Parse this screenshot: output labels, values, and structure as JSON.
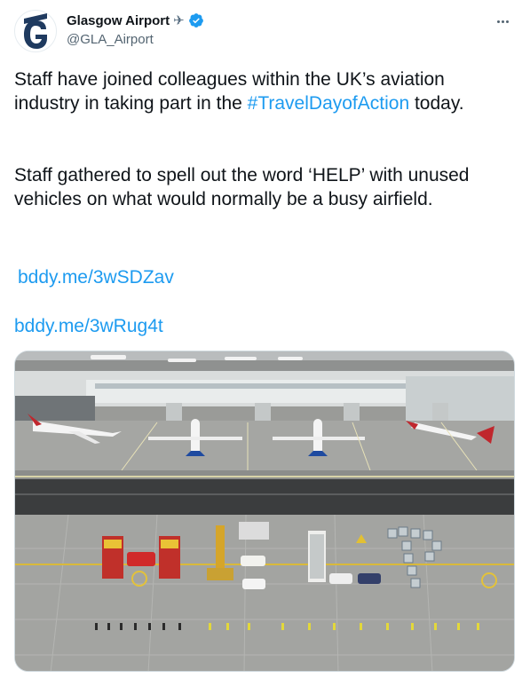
{
  "account": {
    "display_name": "Glasgow Airport",
    "name_emoji": "✈",
    "handle": "@GLA_Airport",
    "avatar_letter": "G"
  },
  "tweet": {
    "p1_text": "Staff have joined colleagues within the UK’s aviation industry in taking part in the ",
    "p1_hashtag": "#TravelDayofAction",
    "p1_end": " today.",
    "p2_text": "Staff gathered to spell out the word ‘HELP’ with unused vehicles on what would normally be a busy airfield.",
    "link1": "bddy.me/3wSDZav",
    "link2": "bddy.me/3wRug4t"
  },
  "colors": {
    "link": "#1d9bf0",
    "verified": "#1d9bf0",
    "brand_navy": "#1f3a5f"
  },
  "icons": {
    "verified": "verified-badge-icon",
    "more": "more-horizontal-icon",
    "plane": "airplane-emoji"
  }
}
